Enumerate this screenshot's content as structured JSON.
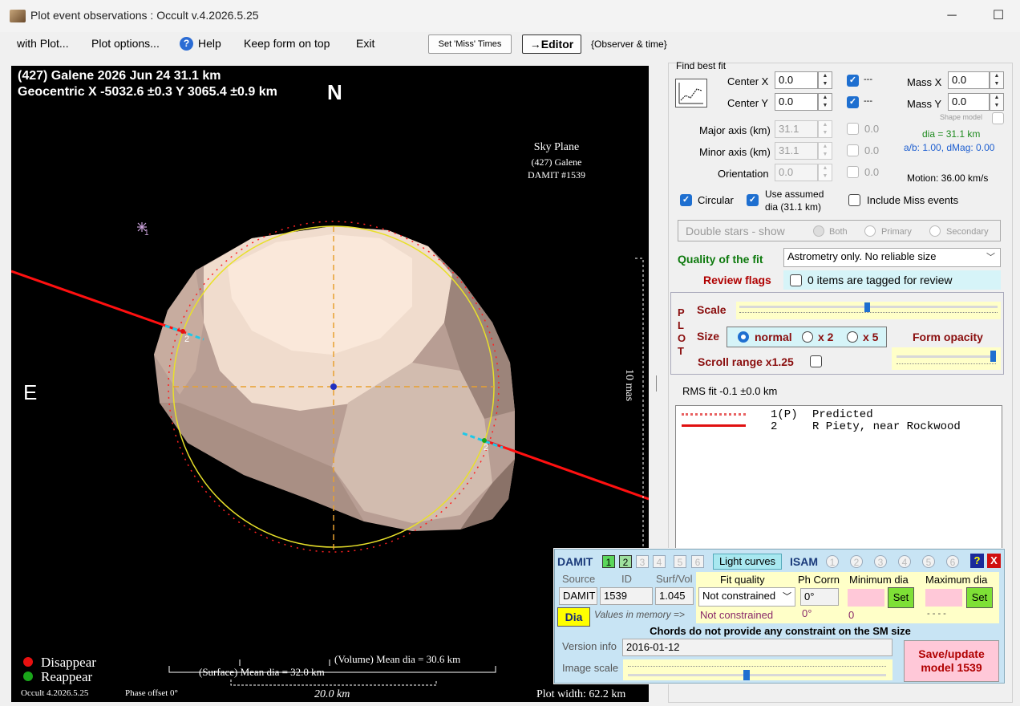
{
  "window": {
    "title": "Plot event observations : Occult v.4.2026.5.25",
    "minimize": "─",
    "maximize": "☐"
  },
  "menu": {
    "with_plot": "with Plot...",
    "plot_options": "Plot options...",
    "help": "Help",
    "keep_on_top": "Keep form on top",
    "exit": "Exit",
    "set_miss": "Set 'Miss' Times",
    "editor": "→Editor",
    "observer_time": "{Observer & time}"
  },
  "plot": {
    "line1": "(427) Galene  2026 Jun 24   31.1 km",
    "line2": "Geocentric  X  -5032.6 ±0.3  Y 3065.4 ±0.9 km",
    "north": "N",
    "east": "E",
    "sky_plane": "Sky Plane",
    "sky_object": "(427) Galene",
    "sky_damit": "DAMIT #1539",
    "scale_label": "10 mas",
    "star_label": "1",
    "chord_label_left": "2",
    "chord_label_right": "2",
    "disappear": "Disappear",
    "reappear": "Reappear",
    "volume_dia": "(Volume) Mean dia = 30.6 km",
    "surface_dia": "(Surface) Mean dia = 32.0 km",
    "scale_km": "20.0 km",
    "version": "Occult 4.2026.5.25",
    "phase_offset": "Phase offset 0°",
    "plot_width": "Plot width: 62.2 km",
    "colors": {
      "disappear": "#e81010",
      "reappear": "#1aa51a",
      "ellipse": "#e8e02a",
      "chord": "#ff1010"
    }
  },
  "fit": {
    "header": "Find best fit",
    "center_x_label": "Center X",
    "center_x": "0.0",
    "center_y_label": "Center Y",
    "center_y": "0.0",
    "mass_x_label": "Mass X",
    "mass_x": "0.0",
    "mass_y_label": "Mass Y",
    "mass_y": "0.0",
    "dash": "---",
    "shape_model": "Shape model",
    "major_label": "Major axis (km)",
    "major": "31.1",
    "major_unc": "0.0",
    "minor_label": "Minor axis (km)",
    "minor": "31.1",
    "minor_unc": "0.0",
    "orient_label": "Orientation",
    "orient": "0.0",
    "orient_unc": "0.0",
    "dia_info": "dia = 31.1 km",
    "ab_info": "a/b: 1.00, dMag: 0.00",
    "motion": "Motion: 36.00 km/s",
    "circular": "Circular",
    "use_assumed": "Use assumed",
    "use_assumed2": "dia (31.1 km)",
    "include_miss": "Include Miss events",
    "double_stars": "Double stars - show",
    "both": "Both",
    "primary": "Primary",
    "secondary": "Secondary",
    "quality_label": "Quality of the fit",
    "quality_value": "Astrometry only. No reliable size",
    "review_label": "Review flags",
    "review_value": "0 items are tagged for review"
  },
  "plotbox": {
    "side": [
      "P",
      "L",
      "O",
      "T"
    ],
    "scale": "Scale",
    "size": "Size",
    "normal": "normal",
    "x2": "x 2",
    "x5": "x 5",
    "form_opacity": "Form opacity",
    "scroll_range": "Scroll range x1.25",
    "scale_level": 0.5,
    "opacity_level": 1.0
  },
  "rms": "RMS fit -0.1 ±0.0 km",
  "legend": {
    "row1_num": "1(P)",
    "row1_text": "Predicted",
    "row2_num": "2",
    "row2_text": "R Piety, near Rockwood"
  },
  "damit": {
    "title": "DAMIT",
    "models": [
      "1",
      "2",
      "3",
      "4",
      "5",
      "6"
    ],
    "light_curves": "Light curves",
    "isam": "ISAM",
    "isam_models": [
      "1",
      "2",
      "3",
      "4",
      "5",
      "6"
    ],
    "q": "?",
    "x": "X",
    "source_h": "Source",
    "id_h": "ID",
    "surf_h": "Surf/Vol",
    "fitq_h": "Fit quality",
    "phcorr_h": "Ph Corrn",
    "mindia_h": "Minimum dia",
    "maxdia_h": "Maximum dia",
    "source": "DAMIT",
    "id": "1539",
    "surf": "1.045",
    "fitq": "Not constrained",
    "phcorr": "0°",
    "set1": "Set",
    "set2": "Set",
    "dia_btn": "Dia",
    "values_mem": "Values in memory =>",
    "mem_fitq": "Not constrained",
    "mem_ph": "0°",
    "mem_min": "0",
    "mem_max": "- - - -",
    "chords_msg": "Chords do not provide any constraint on the SM size",
    "version_label": "Version info",
    "version": "2016-01-12",
    "image_scale": "Image scale",
    "save1": "Save/update",
    "save2": "model 1539"
  }
}
